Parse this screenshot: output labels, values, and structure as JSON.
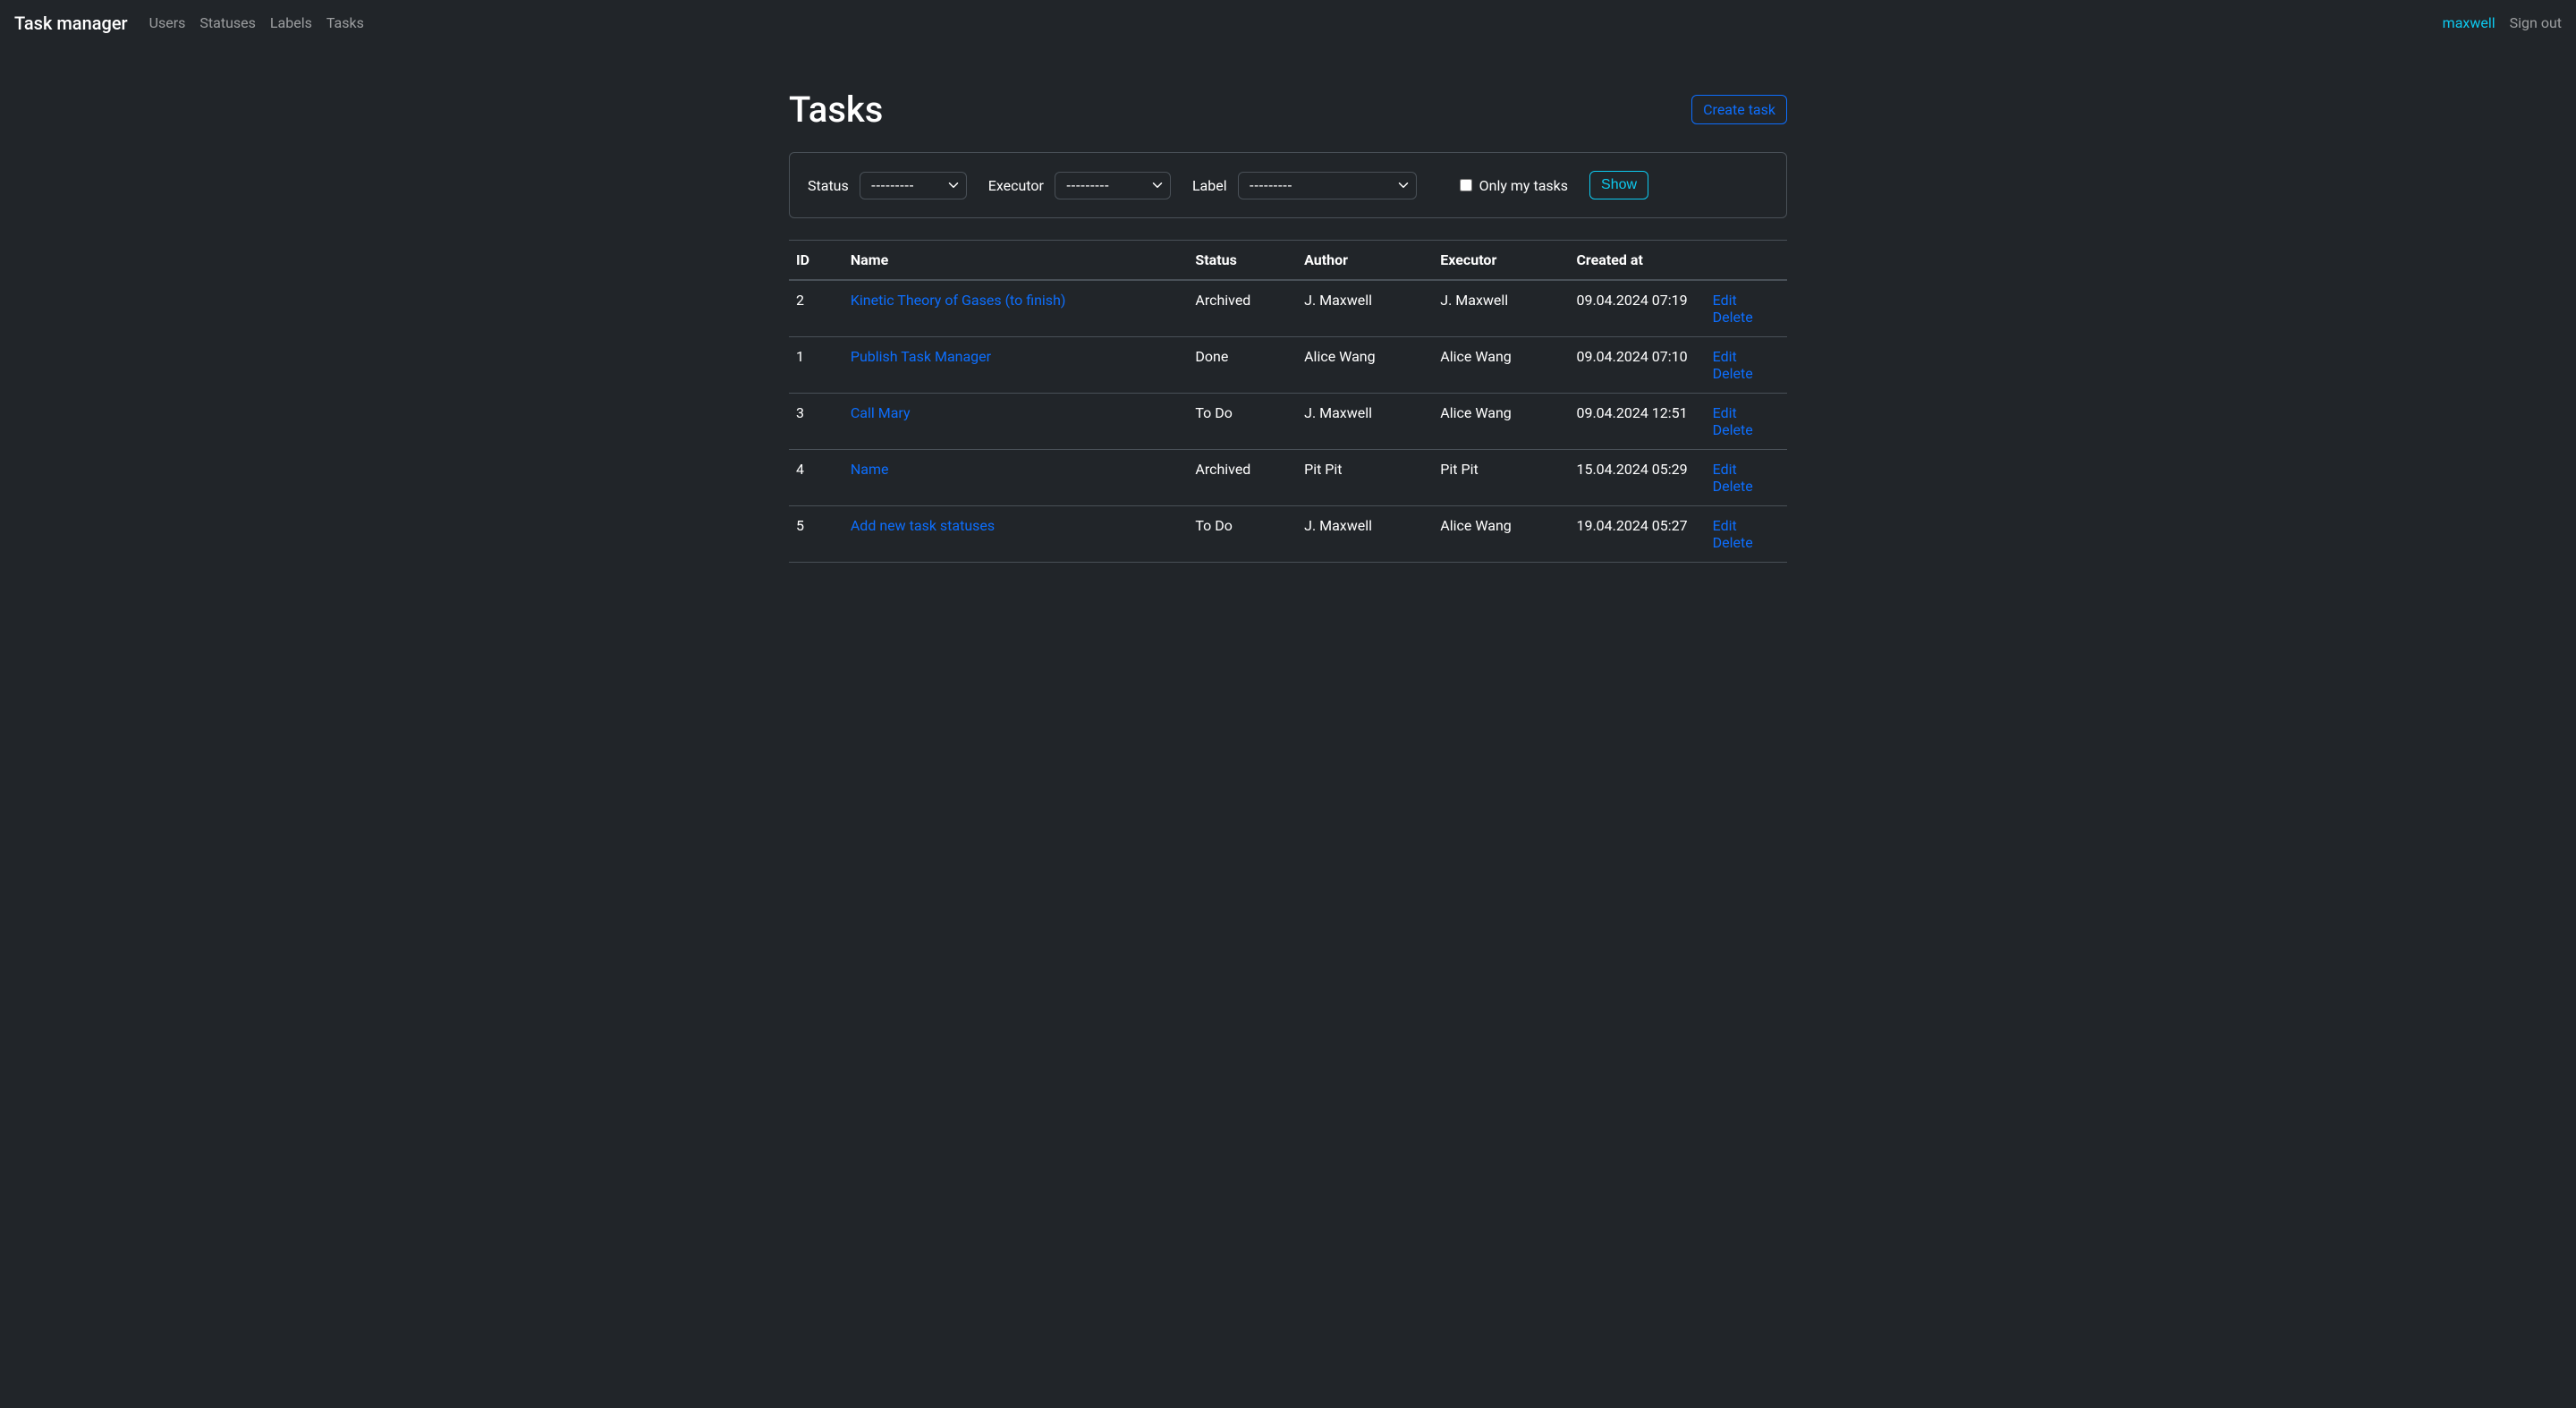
{
  "nav": {
    "brand": "Task manager",
    "links": {
      "users": "Users",
      "statuses": "Statuses",
      "labels": "Labels",
      "tasks": "Tasks"
    },
    "user": "maxwell",
    "signout": "Sign out"
  },
  "page": {
    "title": "Tasks",
    "create_button": "Create task"
  },
  "filters": {
    "status_label": "Status",
    "status_value": "---------",
    "executor_label": "Executor",
    "executor_value": "---------",
    "label_label": "Label",
    "label_value": "---------",
    "only_my_label": "Only my tasks",
    "show_button": "Show"
  },
  "table": {
    "headers": {
      "id": "ID",
      "name": "Name",
      "status": "Status",
      "author": "Author",
      "executor": "Executor",
      "created_at": "Created at"
    },
    "actions": {
      "edit": "Edit",
      "delete": "Delete"
    },
    "rows": [
      {
        "id": "2",
        "name": "Kinetic Theory of Gases (to finish)",
        "status": "Archived",
        "author": "J. Maxwell",
        "executor": "J. Maxwell",
        "created_at": "09.04.2024 07:19"
      },
      {
        "id": "1",
        "name": "Publish Task Manager",
        "status": "Done",
        "author": "Alice Wang",
        "executor": "Alice Wang",
        "created_at": "09.04.2024 07:10"
      },
      {
        "id": "3",
        "name": "Call Mary",
        "status": "To Do",
        "author": "J. Maxwell",
        "executor": "Alice Wang",
        "created_at": "09.04.2024 12:51"
      },
      {
        "id": "4",
        "name": "Name",
        "status": "Archived",
        "author": "Pit Pit",
        "executor": "Pit Pit",
        "created_at": "15.04.2024 05:29"
      },
      {
        "id": "5",
        "name": "Add new task statuses",
        "status": "To Do",
        "author": "J. Maxwell",
        "executor": "Alice Wang",
        "created_at": "19.04.2024 05:27"
      }
    ]
  }
}
